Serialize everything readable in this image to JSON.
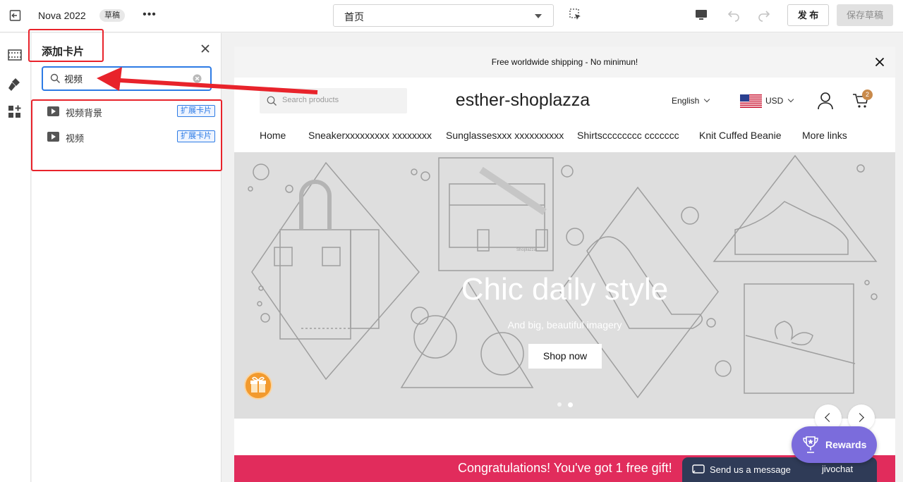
{
  "topbar": {
    "theme_name": "Nova 2022",
    "status_badge": "草稿",
    "more_label": "•••",
    "page_select": "首页",
    "publish_label": "发 布",
    "save_label": "保存草稿"
  },
  "panel": {
    "title": "添加卡片",
    "search_value": "视频",
    "results": [
      {
        "label": "视频背景",
        "tag": "扩展卡片",
        "icon": "video-play-icon"
      },
      {
        "label": "视频",
        "tag": "扩展卡片",
        "icon": "video-play-icon"
      }
    ]
  },
  "preview": {
    "announcement": "Free worldwide shipping - No minimun!",
    "search_placeholder": "Search products",
    "logo": "esther-shoplazza",
    "language": "English",
    "currency": "USD",
    "cart_count": "2",
    "nav": [
      "Home",
      "Sneakerxxxxxxxxx xxxxxxxx",
      "Sunglassesxxx xxxxxxxxxx",
      "Shirtscccccccc ccccccc",
      "Knit Cuffed Beanie",
      "More links"
    ],
    "hero": {
      "title": "Chic daily style",
      "subtitle": "And big, beautiful imagery",
      "button": "Shop now",
      "art_label": "Shoplazza"
    },
    "promo": "Congratulations! You've got 1 free gift!"
  },
  "widgets": {
    "chat_text": "Send us a message",
    "chat_brand": "jivochat",
    "rewards_label": "Rewards"
  },
  "colors": {
    "accent_blue": "#2d7be5",
    "annotation_red": "#e8232b",
    "promo_pink": "#e12c5c",
    "rewards_purple": "#7b6cdc"
  }
}
